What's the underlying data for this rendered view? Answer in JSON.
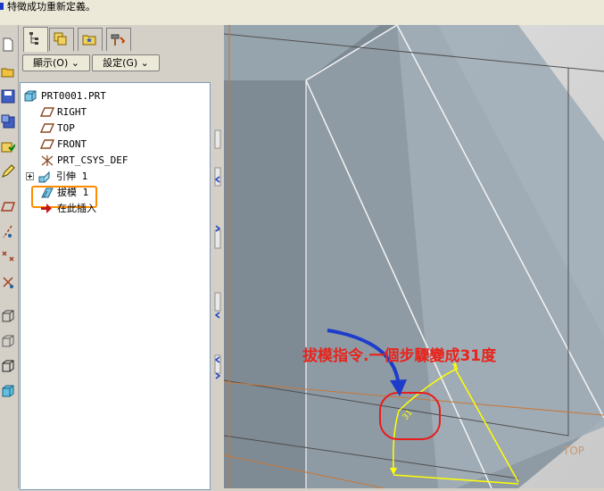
{
  "status": {
    "message": "特徵成功重新定義。"
  },
  "panel": {
    "tabs": [
      {
        "name": "model-tree-tab",
        "icon": "model-tree-icon"
      },
      {
        "name": "layers-tab",
        "icon": "layers-icon"
      },
      {
        "name": "favorites-tab",
        "icon": "folder-star-icon"
      },
      {
        "name": "tools-tab",
        "icon": "hammer-icon"
      }
    ],
    "show_menu": "顯示(O) ⌄",
    "settings_menu": "設定(G) ⌄"
  },
  "tree": {
    "items": [
      {
        "label": "PRT0001.PRT",
        "icon": "part-icon"
      },
      {
        "label": "RIGHT",
        "icon": "datum-plane-icon"
      },
      {
        "label": "TOP",
        "icon": "datum-plane-icon"
      },
      {
        "label": "FRONT",
        "icon": "datum-plane-icon"
      },
      {
        "label": "PRT_CSYS_DEF",
        "icon": "csys-icon"
      },
      {
        "label": "引伸 1",
        "icon": "extrude-icon"
      },
      {
        "label": "拔模 1",
        "icon": "draft-icon"
      },
      {
        "label": "在此插入",
        "icon": "insert-here-icon"
      }
    ]
  },
  "viewport": {
    "annotation": "拔模指令.一個步驟變成31度",
    "datum_label": "TOP",
    "colors": {
      "annotation": "#e8241c",
      "arrow": "#1e3ccc",
      "highlight": "#ff8c00",
      "dimension": "#ffff00"
    }
  }
}
